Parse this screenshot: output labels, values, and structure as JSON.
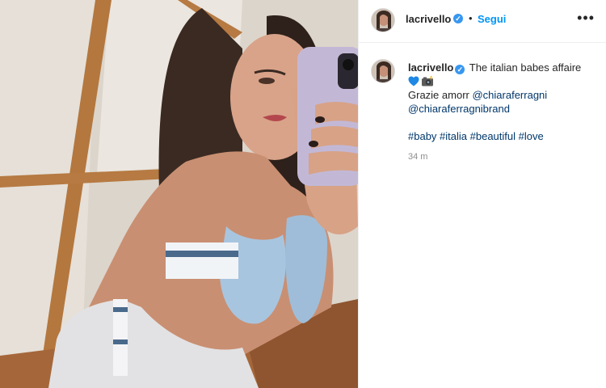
{
  "post": {
    "username": "lacrivello",
    "follow_label": "Segui",
    "dot": "•",
    "more_label": "•••",
    "caption_text": "The italian babes affaire",
    "caption_line2_prefix": "Grazie amorr",
    "mentions": [
      "@chiaraferragni",
      "@chiaraferragnibrand"
    ],
    "hashtags": [
      "#baby",
      "#italia",
      "#beautiful",
      "#love"
    ],
    "timestamp": "34 m",
    "emojis": [
      "blue-heart-icon",
      "camera-flash-icon"
    ]
  },
  "colors": {
    "accent": "#0095f6",
    "verified": "#3897f0",
    "link": "#00376b",
    "muted": "#8e8e8e",
    "text": "#262626"
  }
}
